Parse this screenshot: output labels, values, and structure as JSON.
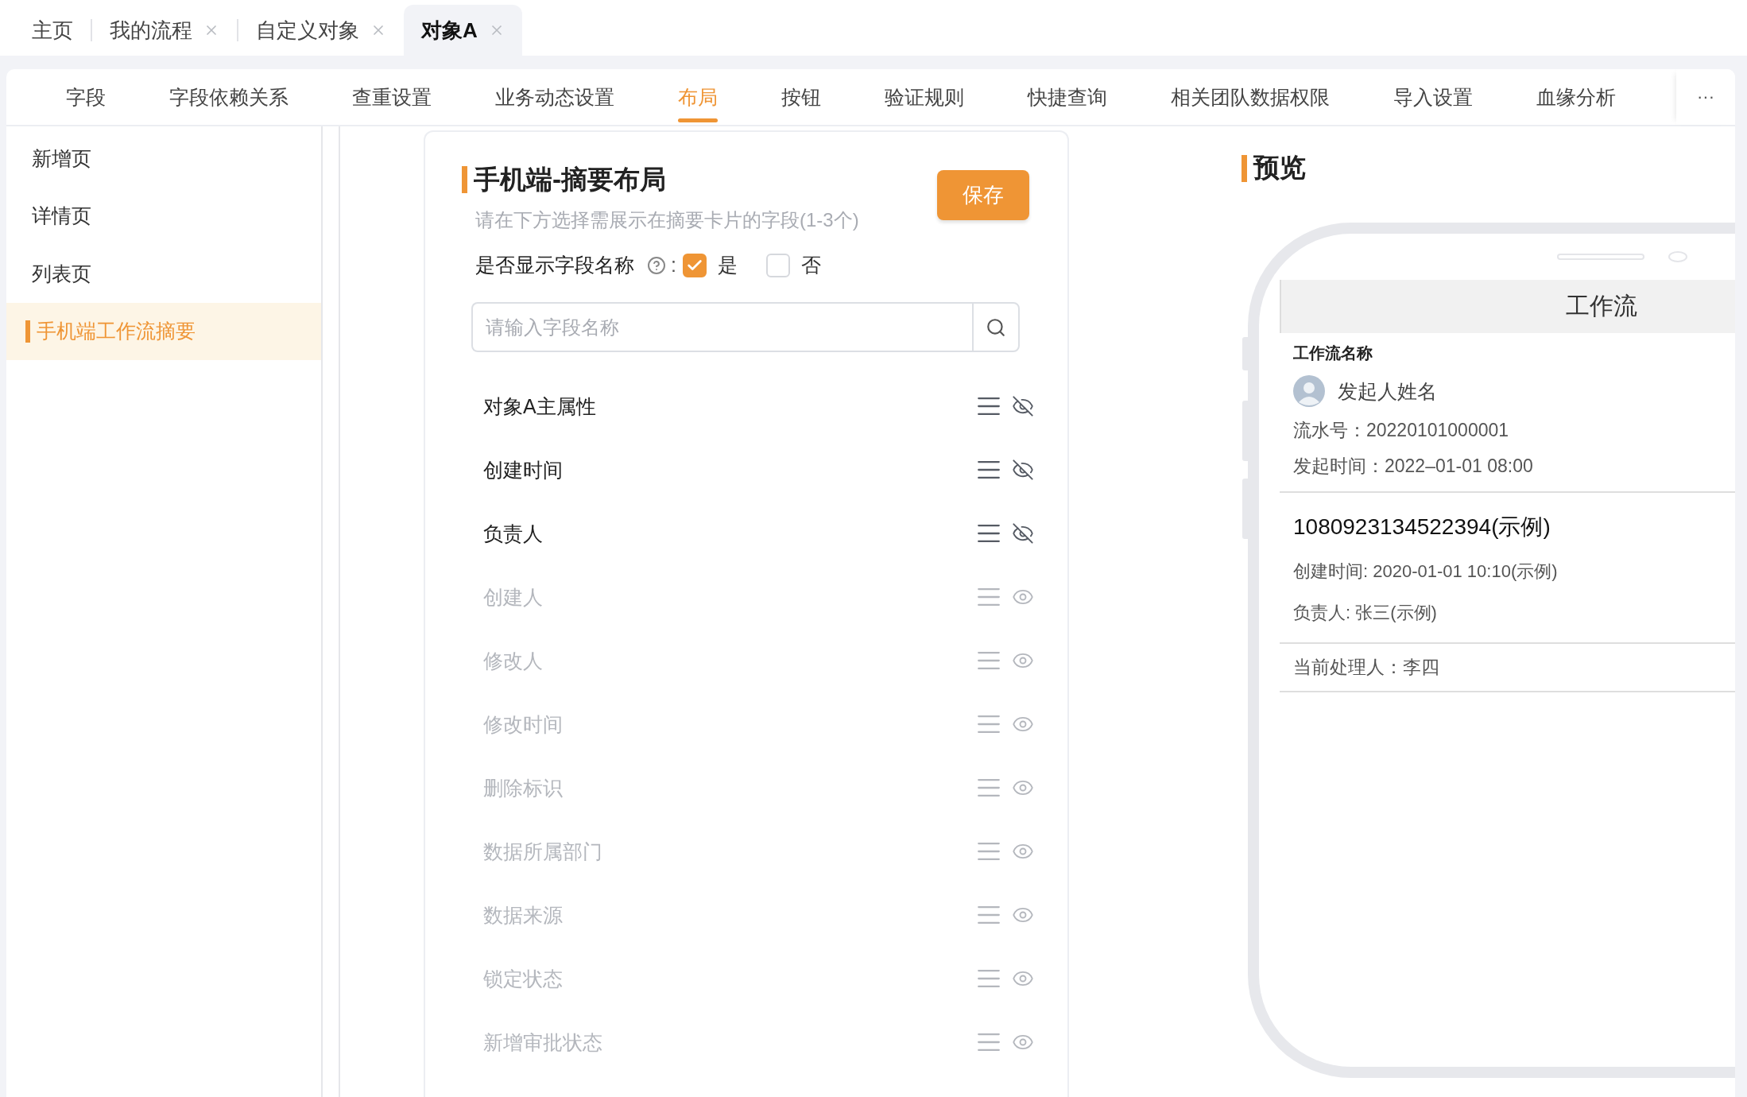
{
  "page_tabs": [
    {
      "label": "主页",
      "closable": false,
      "selected": false
    },
    {
      "label": "我的流程",
      "closable": true,
      "selected": false
    },
    {
      "label": "自定义对象",
      "closable": true,
      "selected": false
    },
    {
      "label": "对象A",
      "closable": true,
      "selected": true
    }
  ],
  "nav_tabs": [
    {
      "label": "字段",
      "selected": false
    },
    {
      "label": "字段依赖关系",
      "selected": false
    },
    {
      "label": "查重设置",
      "selected": false
    },
    {
      "label": "业务动态设置",
      "selected": false
    },
    {
      "label": "布局",
      "selected": true
    },
    {
      "label": "按钮",
      "selected": false
    },
    {
      "label": "验证规则",
      "selected": false
    },
    {
      "label": "快捷查询",
      "selected": false
    },
    {
      "label": "相关团队数据权限",
      "selected": false
    },
    {
      "label": "导入设置",
      "selected": false
    },
    {
      "label": "血缘分析",
      "selected": false
    }
  ],
  "more_label": "···",
  "sidebar": {
    "items": [
      {
        "label": "新增页",
        "selected": false
      },
      {
        "label": "详情页",
        "selected": false
      },
      {
        "label": "列表页",
        "selected": false
      },
      {
        "label": "手机端工作流摘要",
        "selected": true
      }
    ]
  },
  "layout_panel": {
    "title": "手机端-摘要布局",
    "save_button": "保存",
    "hint": "请在下方选择需展示在摘要卡片的字段(1-3个)",
    "show_names": {
      "label": "是否显示字段名称",
      "colon": ":",
      "options": [
        {
          "label": "是",
          "checked": true
        },
        {
          "label": "否",
          "checked": false
        }
      ]
    },
    "search": {
      "placeholder": "请输入字段名称"
    },
    "fields": [
      {
        "label": "对象A主属性",
        "shown": true
      },
      {
        "label": "创建时间",
        "shown": true
      },
      {
        "label": "负责人",
        "shown": true
      },
      {
        "label": "创建人",
        "shown": false
      },
      {
        "label": "修改人",
        "shown": false
      },
      {
        "label": "修改时间",
        "shown": false
      },
      {
        "label": "删除标识",
        "shown": false
      },
      {
        "label": "数据所属部门",
        "shown": false
      },
      {
        "label": "数据来源",
        "shown": false
      },
      {
        "label": "锁定状态",
        "shown": false
      },
      {
        "label": "新增审批状态",
        "shown": false
      }
    ]
  },
  "preview": {
    "title": "预览",
    "phone": {
      "header": "工作流",
      "workflow_name": "工作流名称",
      "initiator": "发起人姓名",
      "serial": "流水号：20220101000001",
      "start_time": "发起时间：2022–01-01 08:00",
      "record_id": "1080923134522394(示例)",
      "created": "创建时间: 2020-01-01 10:10(示例)",
      "owner": "负责人: 张三(示例)",
      "handler": "当前处理人：李四"
    }
  }
}
